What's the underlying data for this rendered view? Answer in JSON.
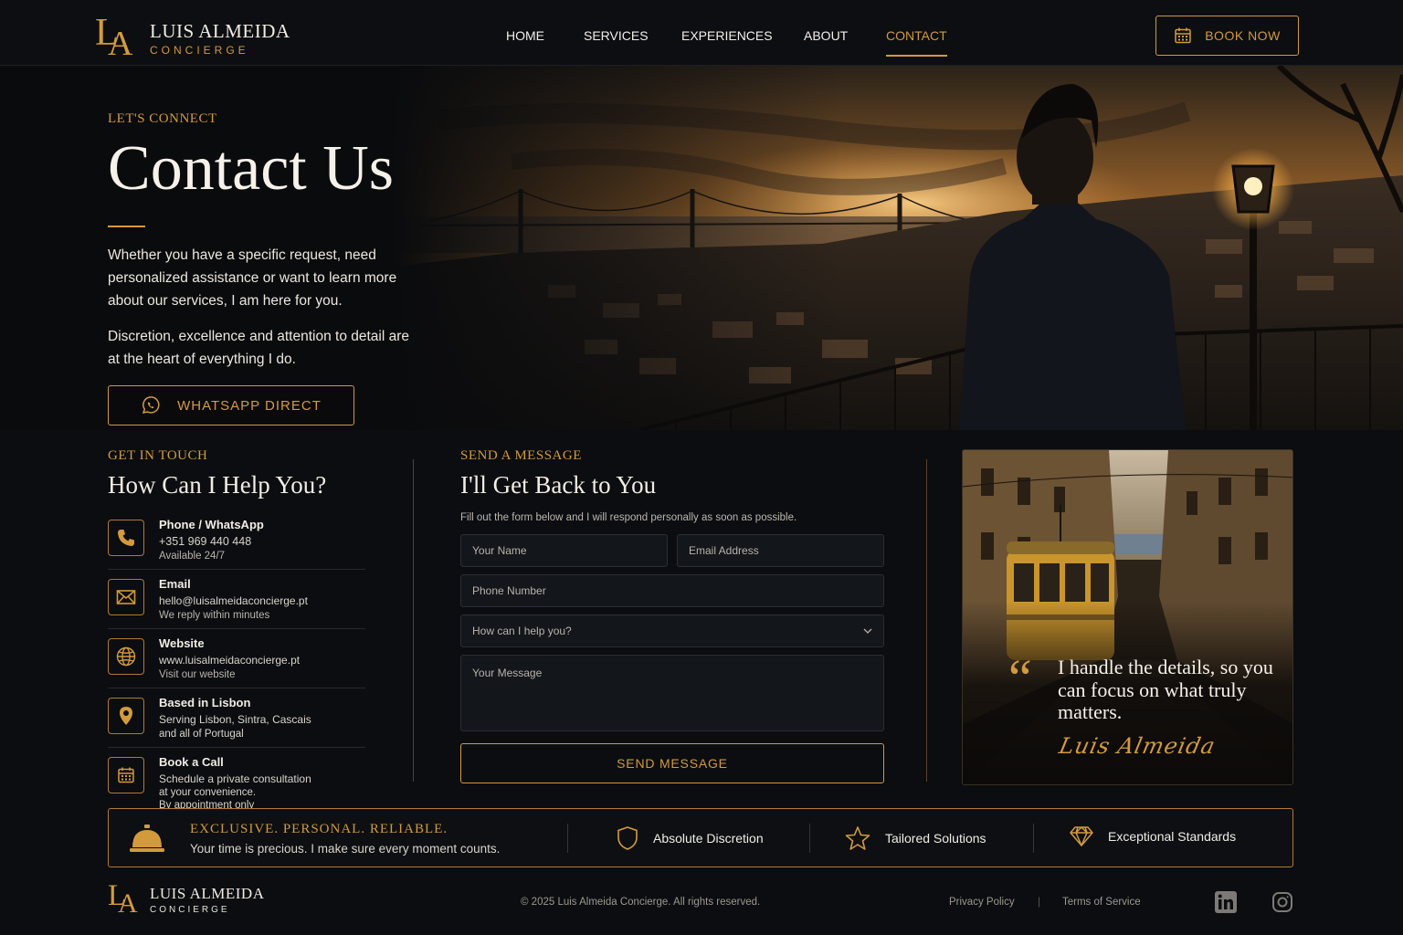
{
  "brand": {
    "initials_l": "L",
    "initials_a": "A",
    "name": "LUIS ALMEIDA",
    "tagline": "CONCIERGE"
  },
  "nav": {
    "items": [
      {
        "label": "HOME",
        "active": false
      },
      {
        "label": "SERVICES",
        "active": false
      },
      {
        "label": "EXPERIENCES",
        "active": false
      },
      {
        "label": "ABOUT",
        "active": false
      },
      {
        "label": "CONTACT",
        "active": true
      }
    ],
    "book_label": "BOOK NOW"
  },
  "hero": {
    "eyebrow": "LET'S CONNECT",
    "title": "Contact Us",
    "paragraph1": "Whether you have a specific request, need personalized assistance or want to learn more about our services, I am here for you.",
    "paragraph2": "Discretion, excellence and attention to detail are at the heart of everything I do.",
    "whatsapp_label": "WHATSAPP DIRECT"
  },
  "contact_info": {
    "eyebrow": "GET IN TOUCH",
    "title": "How Can I Help You?",
    "items": [
      {
        "icon": "phone-icon",
        "heading": "Phone / WhatsApp",
        "value": "+351 969 440 448",
        "note": "Available 24/7"
      },
      {
        "icon": "mail-icon",
        "heading": "Email",
        "value": "hello@luisalmeidaconcierge.pt",
        "note": "We reply within minutes"
      },
      {
        "icon": "globe-icon",
        "heading": "Website",
        "value": "www.luisalmeidaconcierge.pt",
        "note": "Visit our website"
      },
      {
        "icon": "map-pin-icon",
        "heading": "Based in Lisbon",
        "value": "Serving Lisbon, Sintra, Cascais",
        "note": "and all of Portugal"
      },
      {
        "icon": "calendar-icon",
        "heading": "Book a Call",
        "value": "Schedule a private consultation",
        "value2": "at your convenience.",
        "note": "By appointment only"
      }
    ]
  },
  "form": {
    "eyebrow": "SEND A MESSAGE",
    "title": "I'll Get Back to You",
    "subtitle": "Fill out the form below and I will respond personally as soon as possible.",
    "name_placeholder": "Your Name",
    "email_placeholder": "Email Address",
    "phone_placeholder": "Phone Number",
    "help_select": "How can I help you?",
    "message_placeholder": "Your Message",
    "submit_label": "SEND MESSAGE"
  },
  "quote": {
    "mark": "“",
    "text": "I handle the details, so you can focus on what truly matters.",
    "signature": "Luis Almeida"
  },
  "band": {
    "title": "EXCLUSIVE. PERSONAL. RELIABLE.",
    "subtitle": "Your time is precious. I make sure every moment counts.",
    "features": [
      {
        "icon": "shield-icon",
        "label": "Absolute Discretion"
      },
      {
        "icon": "star-icon",
        "label": "Tailored Solutions"
      },
      {
        "icon": "diamond-icon",
        "label": "Exceptional Standards"
      }
    ]
  },
  "footer": {
    "copyright": "© 2025 Luis Almeida Concierge. All rights reserved.",
    "privacy": "Privacy Policy",
    "separator": "|",
    "terms": "Terms of Service",
    "social": [
      "linkedin-icon",
      "instagram-icon"
    ]
  },
  "colors": {
    "accent": "#d39a3c",
    "background": "#0b0d10",
    "text": "#e8e4dc"
  }
}
